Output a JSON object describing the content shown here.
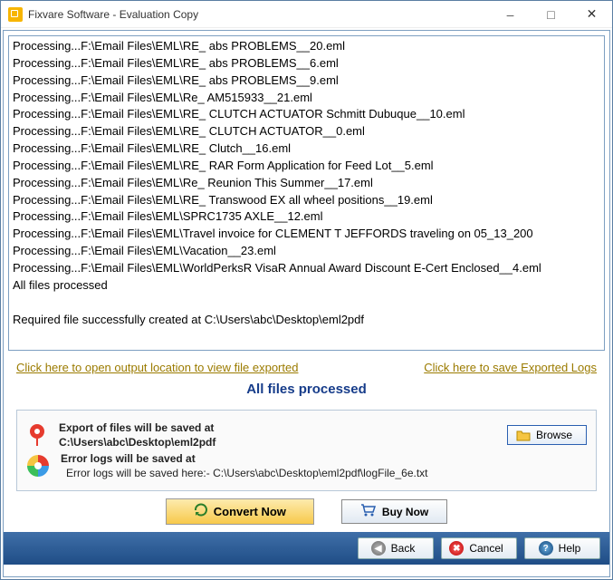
{
  "window": {
    "title": "Fixvare Software - Evaluation Copy"
  },
  "log_lines": [
    "Processing...F:\\Email Files\\EML\\RE_ abs PROBLEMS__20.eml",
    "Processing...F:\\Email Files\\EML\\RE_ abs PROBLEMS__6.eml",
    "Processing...F:\\Email Files\\EML\\RE_ abs PROBLEMS__9.eml",
    "Processing...F:\\Email Files\\EML\\Re_ AM515933__21.eml",
    "Processing...F:\\Email Files\\EML\\RE_ CLUTCH ACTUATOR Schmitt Dubuque__10.eml",
    "Processing...F:\\Email Files\\EML\\RE_ CLUTCH ACTUATOR__0.eml",
    "Processing...F:\\Email Files\\EML\\RE_ Clutch__16.eml",
    "Processing...F:\\Email Files\\EML\\RE_ RAR Form Application for Feed Lot__5.eml",
    "Processing...F:\\Email Files\\EML\\Re_ Reunion This Summer__17.eml",
    "Processing...F:\\Email Files\\EML\\RE_ Transwood EX all wheel positions__19.eml",
    "Processing...F:\\Email Files\\EML\\SPRC1735 AXLE__12.eml",
    "Processing...F:\\Email Files\\EML\\Travel invoice for CLEMENT T JEFFORDS traveling on 05_13_200",
    "Processing...F:\\Email Files\\EML\\Vacation__23.eml",
    "Processing...F:\\Email Files\\EML\\WorldPerksR VisaR Annual Award Discount E-Cert Enclosed__4.eml",
    "All files processed",
    "",
    "Required file successfully created at C:\\Users\\abc\\Desktop\\eml2pdf"
  ],
  "links": {
    "open_output": "Click here to open output location to view file exported",
    "save_logs": "Click here to save Exported Logs"
  },
  "status": "All files processed",
  "export": {
    "label": "Export of files will be saved at",
    "path": "C:\\Users\\abc\\Desktop\\eml2pdf",
    "browse": "Browse"
  },
  "errorlogs": {
    "label": "Error logs will be saved at",
    "path": "Error logs will be saved here:- C:\\Users\\abc\\Desktop\\eml2pdf\\logFile_6e.txt"
  },
  "actions": {
    "convert": "Convert Now",
    "buy": "Buy Now"
  },
  "footer": {
    "back": "Back",
    "cancel": "Cancel",
    "help": "Help"
  }
}
